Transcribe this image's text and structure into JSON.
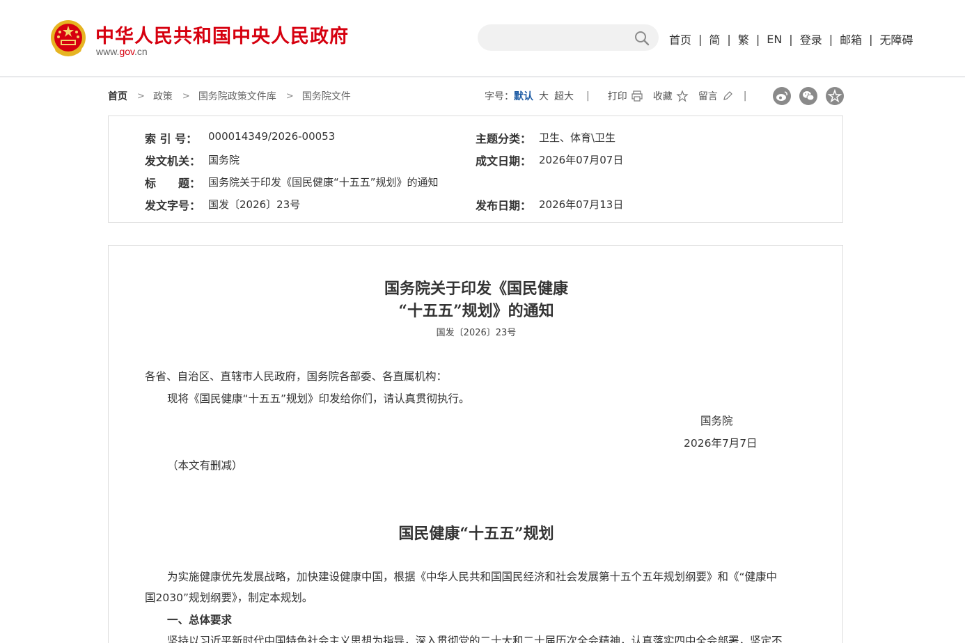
{
  "header": {
    "site_title": "中华人民共和国中央人民政府",
    "domain_prefix": "www.",
    "domain_gov": "gov",
    "domain_suffix": ".cn",
    "search_placeholder": "",
    "nav": [
      "首页",
      "简",
      "繁",
      "EN",
      "登录",
      "邮箱",
      "无障碍"
    ],
    "nav_separator": "|"
  },
  "breadcrumb": {
    "items": [
      "首页",
      "政策",
      "国务院政策文件库",
      "国务院文件"
    ],
    "chevron": ">"
  },
  "tools": {
    "font_size_label": "字号：",
    "font_default": "默认",
    "font_large": "大",
    "font_xlarge": "超大",
    "separator": "|",
    "print": "打印",
    "favorite": "收藏",
    "comment": "留言"
  },
  "share_icons": [
    "weibo-icon",
    "wechat-icon",
    "favorite-star-icon"
  ],
  "meta": {
    "index_label": "索 引 号：",
    "index_value": "000014349/2026-00053",
    "subject_label": "主题分类：",
    "subject_value": "卫生、体育\\卫生",
    "issuer_label": "发文机关：",
    "issuer_value": "国务院",
    "written_date_label": "成文日期：",
    "written_date_value": "2026年07月07日",
    "title_label": "标　　题：",
    "title_value": "国务院关于印发《国民健康“十五五”规划》的通知",
    "doc_no_label": "发文字号：",
    "doc_no_value": "国发〔2026〕23号",
    "publish_date_label": "发布日期：",
    "publish_date_value": "2026年07月13日"
  },
  "article": {
    "title_line1": "国务院关于印发《国民健康",
    "title_line2": "“十五五”规划》的通知",
    "doc_no": "国发〔2026〕23号",
    "salutation": "各省、自治区、直辖市人民政府，国务院各部委、各直属机构：",
    "body1": "现将《国民健康“十五五”规划》印发给你们，请认真贯彻执行。",
    "signature": "国务院",
    "sign_date": "2026年7月7日",
    "abridged_note": "（本文有删减）",
    "plan_title": "国民健康“十五五”规划",
    "plan_intro_line1": "为实施健康优先发展战略，加快建设健康中国，根据《中华人民共和国国民经济和社会发展第十五个五年规划纲要》和《“健康中",
    "plan_intro_line2": "国2030”规划纲要》，制定本规划。",
    "section1_heading": "一、总体要求",
    "section1_line1": "坚持以习近平新时代中国特色社会主义思想为指导，深入贯彻党的二十大和二十届历次全会精神，认真落实四中全会部署，坚定不"
  },
  "colors": {
    "brand_red": "#d6000f",
    "link_blue": "#1d5ba4",
    "border": "#dcdcdc"
  }
}
